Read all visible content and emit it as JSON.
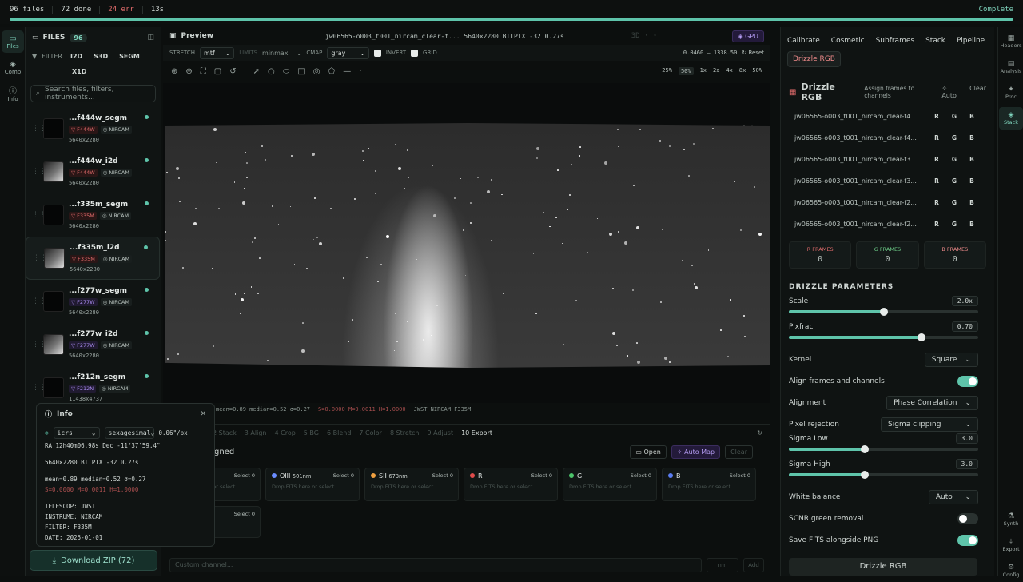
{
  "topbar": {
    "files": "96 files",
    "done": "72 done",
    "err": "24 err",
    "time": "13s",
    "status": "Complete",
    "progress": 1.0
  },
  "left_rail": [
    {
      "label": "Files",
      "icon": "folder-icon",
      "active": true
    },
    {
      "label": "Comp",
      "icon": "layers-icon",
      "active": false
    },
    {
      "label": "Info",
      "icon": "info-icon",
      "active": false
    }
  ],
  "files": {
    "title": "FILES",
    "count": "96",
    "filter_label": "FILTER",
    "filter_chips": [
      "I2D",
      "S3D",
      "SEGM",
      "X1D"
    ],
    "search_placeholder": "Search files, filters, instruments...",
    "items": [
      {
        "name": "...f444w_segm",
        "filter": "F444W",
        "instrument": "NIRCAM",
        "dims": "5640x2280",
        "kind": "segm",
        "tagcolor": "red"
      },
      {
        "name": "...f444w_i2d",
        "filter": "F444W",
        "instrument": "NIRCAM",
        "dims": "5640x2280",
        "kind": "i2d",
        "tagcolor": "red"
      },
      {
        "name": "...f335m_segm",
        "filter": "F335M",
        "instrument": "NIRCAM",
        "dims": "5640x2280",
        "kind": "segm",
        "tagcolor": "red"
      },
      {
        "name": "...f335m_i2d",
        "filter": "F335M",
        "instrument": "NIRCAM",
        "dims": "5640x2280",
        "kind": "i2d",
        "tagcolor": "red"
      },
      {
        "name": "...f277w_segm",
        "filter": "F277W",
        "instrument": "NIRCAM",
        "dims": "5640x2280",
        "kind": "segm",
        "tagcolor": "purple"
      },
      {
        "name": "...f277w_i2d",
        "filter": "F277W",
        "instrument": "NIRCAM",
        "dims": "5640x2280",
        "kind": "i2d",
        "tagcolor": "purple"
      },
      {
        "name": "...f212n_segm",
        "filter": "F212N",
        "instrument": "NIRCAM",
        "dims": "11438x4737",
        "kind": "segm",
        "tagcolor": "purple"
      }
    ],
    "download_label": "Download ZIP (72)"
  },
  "preview": {
    "title": "Preview",
    "fileinfo": "jw06565-o003_t001_nircam_clear-f... 5640×2280 BITPIX -32 0.27s",
    "gpu": "GPU",
    "stretch_label": "STRETCH",
    "stretch_value": "mtf",
    "limits_label": "LIMITS",
    "limits_value": "minmax",
    "cmap_label": "CMAP",
    "cmap_value": "gray",
    "invert_label": "INVERT",
    "grid_label": "GRID",
    "range": "0.0460 – 1338.50",
    "reset": "Reset",
    "zoom_levels": [
      "25%",
      "50%",
      "1x",
      "2x",
      "4x",
      "8x",
      "50%"
    ],
    "status_stats": "mean=0.89 median=0.52 σ=0.27",
    "status_stats2": "S=0.0000 M=0.0011 H=1.0000",
    "status_meta": "JWST NIRCAM F335M"
  },
  "pipeline": {
    "steps": [
      "2 Stack",
      "3 Align",
      "4 Crop",
      "5 BG",
      "6 Blend",
      "7 Color",
      "8 Stretch",
      "9 Adjust",
      "10 Export"
    ],
    "current_step": "10 Export",
    "assign_title": "signed",
    "open_label": "Open",
    "automap_label": "Auto Map",
    "clear_label": "Clear",
    "channels": [
      {
        "name": "",
        "nm": "",
        "color": "#888888",
        "select": "Select 0",
        "drop": "Drop FITS here or select"
      },
      {
        "name": "OIII",
        "nm": "501nm",
        "color": "#6a8cff",
        "select": "Select 0",
        "drop": "Drop FITS here or select"
      },
      {
        "name": "SII",
        "nm": "673nm",
        "color": "#f0a040",
        "select": "Select 0",
        "drop": "Drop FITS here or select"
      },
      {
        "name": "R",
        "nm": "",
        "color": "#e04b4b",
        "select": "Select 0",
        "drop": "Drop FITS here or select"
      },
      {
        "name": "G",
        "nm": "",
        "color": "#4cc46a",
        "select": "Select 0",
        "drop": "Drop FITS here or select"
      },
      {
        "name": "B",
        "nm": "",
        "color": "#5a7cf0",
        "select": "Select 0",
        "drop": "Drop FITS here or select"
      }
    ],
    "extra_select": "Select 0",
    "extra_drop": "re or select",
    "custom_placeholder": "Custom channel...",
    "nm_button": "nm",
    "add_button": "Add"
  },
  "info": {
    "title": "Info",
    "frame": "icrs",
    "format": "sexagesimal",
    "scale": "0.06\"/px",
    "ra_dec": "RA 12h40m06.98s  Dec -11°37'59.4\"",
    "dims_line": "5640×2280  BITPIX -32  0.27s",
    "stats1": "mean=0.89  median=0.52  σ=0.27",
    "stats2": "S=0.0000  M=0.0011  H=1.0000",
    "telescope": "TELESCOP: JWST",
    "instrument": "INSTRUME: NIRCAM",
    "filter": "FILTER: F335M",
    "date": "DATE: 2025-01-01"
  },
  "side": {
    "tabs": [
      "Calibrate",
      "Cosmetic",
      "Subframes",
      "Stack",
      "Pipeline",
      "Drizzle RGB"
    ],
    "active_tab": "Drizzle RGB",
    "drizzle_title": "Drizzle RGB",
    "drizzle_sub": "Assign frames to channels",
    "auto": "Auto",
    "clear": "Clear",
    "frames": [
      "jw06565-o003_t001_nircam_clear-f4...",
      "jw06565-o003_t001_nircam_clear-f4...",
      "jw06565-o003_t001_nircam_clear-f3...",
      "jw06565-o003_t001_nircam_clear-f3...",
      "jw06565-o003_t001_nircam_clear-f2...",
      "jw06565-o003_t001_nircam_clear-f2..."
    ],
    "rgb": [
      "R",
      "G",
      "B"
    ],
    "counts": [
      {
        "label": "R FRAMES",
        "value": "0",
        "color": "#e06b6b"
      },
      {
        "label": "G FRAMES",
        "value": "0",
        "color": "#6fd08a"
      },
      {
        "label": "B FRAMES",
        "value": "0",
        "color": "#f08b8b"
      }
    ],
    "params_title": "DRIZZLE PARAMETERS",
    "scale_label": "Scale",
    "scale_value": "2.0x",
    "scale_fill": 0.5,
    "pixfrac_label": "Pixfrac",
    "pixfrac_value": "0.70",
    "pixfrac_fill": 0.7,
    "kernel_label": "Kernel",
    "kernel_value": "Square",
    "align_label": "Align frames and channels",
    "alignment_label": "Alignment",
    "alignment_value": "Phase Correlation",
    "rejection_label": "Pixel rejection",
    "rejection_value": "Sigma clipping",
    "siglow_label": "Sigma Low",
    "siglow_value": "3.0",
    "siglow_fill": 0.4,
    "sighigh_label": "Sigma High",
    "sighigh_value": "3.0",
    "sighigh_fill": 0.4,
    "wb_label": "White balance",
    "wb_value": "Auto",
    "scnr_label": "SCNR green removal",
    "savefits_label": "Save FITS alongside PNG",
    "button": "Drizzle RGB"
  },
  "right_rail": [
    {
      "label": "Headers",
      "icon": "grid-icon"
    },
    {
      "label": "Analysis",
      "icon": "chart-icon"
    },
    {
      "label": "Proc",
      "icon": "sparkle-icon"
    },
    {
      "label": "Stack",
      "icon": "layers-icon"
    },
    {
      "label": "Synth",
      "icon": "flask-icon"
    },
    {
      "label": "Export",
      "icon": "export-icon"
    },
    {
      "label": "Config",
      "icon": "gear-icon"
    }
  ]
}
